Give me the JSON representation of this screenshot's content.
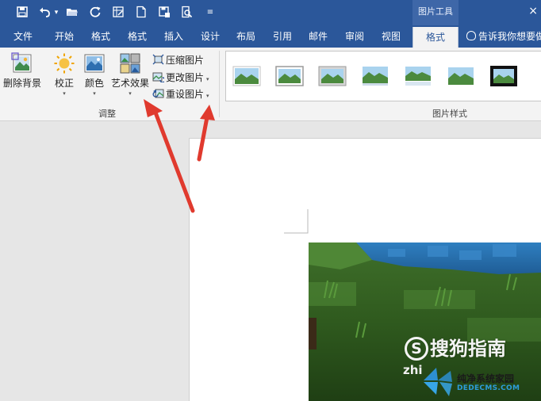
{
  "titlebar": {
    "context_tool": "图片工具",
    "quick_access": [
      {
        "name": "save-icon"
      },
      {
        "name": "undo-icon"
      },
      {
        "name": "open-folder-icon"
      },
      {
        "name": "redo-circle-icon"
      },
      {
        "name": "form-icon"
      },
      {
        "name": "new-doc-icon"
      },
      {
        "name": "save-as-icon"
      },
      {
        "name": "print-preview-icon"
      },
      {
        "name": "customize-dropdown-icon"
      }
    ]
  },
  "tabs": [
    {
      "label": "文件",
      "active": false
    },
    {
      "label": "开始",
      "active": false
    },
    {
      "label": "格式",
      "active": false
    },
    {
      "label": "格式",
      "active": false
    },
    {
      "label": "插入",
      "active": false
    },
    {
      "label": "设计",
      "active": false
    },
    {
      "label": "布局",
      "active": false
    },
    {
      "label": "引用",
      "active": false
    },
    {
      "label": "邮件",
      "active": false
    },
    {
      "label": "审阅",
      "active": false
    },
    {
      "label": "视图",
      "active": false
    },
    {
      "label": "格式",
      "active": true
    }
  ],
  "tell_me": "告诉我你想要做",
  "ribbon": {
    "adjust": {
      "remove_bg": "删除背景",
      "correct": "校正",
      "color": "颜色",
      "art_effects": "艺术效果",
      "compress": "压缩图片",
      "change": "更改图片",
      "reset": "重设图片",
      "group_label": "调整"
    },
    "styles": {
      "group_label": "图片样式"
    }
  },
  "colors": {
    "brand": "#2b579a",
    "arrow": "#e03a2e"
  },
  "watermark": {
    "logo_letter": "S",
    "sogou": "搜狗指南",
    "zhi": "zhi",
    "site": "纯净系统家园",
    "dede": "DEDECMS.COM"
  }
}
